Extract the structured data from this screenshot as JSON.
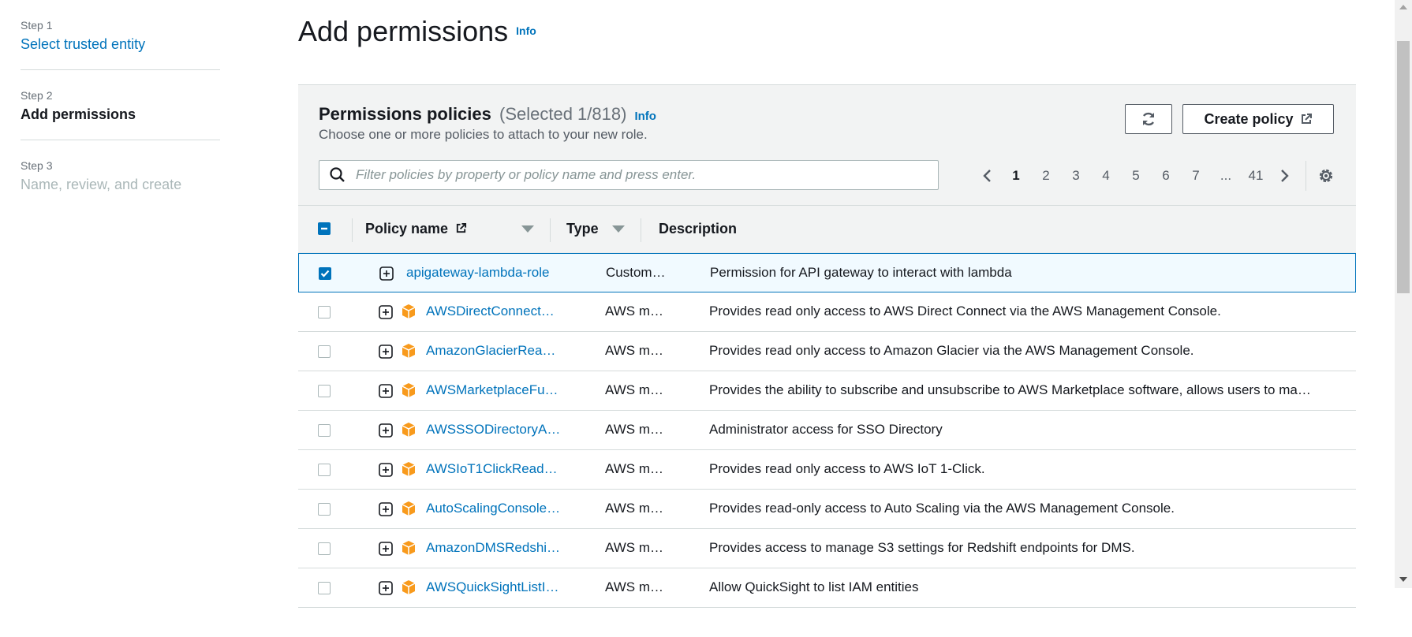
{
  "steps": [
    {
      "num": "Step 1",
      "label": "Select trusted entity",
      "state": "link"
    },
    {
      "num": "Step 2",
      "label": "Add permissions",
      "state": "current"
    },
    {
      "num": "Step 3",
      "label": "Name, review, and create",
      "state": "disabled"
    }
  ],
  "page": {
    "title": "Add permissions",
    "info": "Info"
  },
  "panel": {
    "title": "Permissions policies",
    "counter": "(Selected 1/818)",
    "info": "Info",
    "description": "Choose one or more policies to attach to your new role.",
    "create_button": "Create policy",
    "search_placeholder": "Filter policies by property or policy name and press enter."
  },
  "pagination": {
    "pages": [
      "1",
      "2",
      "3",
      "4",
      "5",
      "6",
      "7",
      "...",
      "41"
    ],
    "current": "1"
  },
  "table": {
    "headers": {
      "name": "Policy name",
      "type": "Type",
      "description": "Description"
    },
    "rows": [
      {
        "name": "apigateway-lambda-role",
        "type": "Custom…",
        "description": "Permission for API gateway to interact with lambda",
        "selected": true,
        "aws_managed": false
      },
      {
        "name": "AWSDirectConnect…",
        "type": "AWS m…",
        "description": "Provides read only access to AWS Direct Connect via the AWS Management Console.",
        "selected": false,
        "aws_managed": true
      },
      {
        "name": "AmazonGlacierRea…",
        "type": "AWS m…",
        "description": "Provides read only access to Amazon Glacier via the AWS Management Console.",
        "selected": false,
        "aws_managed": true
      },
      {
        "name": "AWSMarketplaceFu…",
        "type": "AWS m…",
        "description": "Provides the ability to subscribe and unsubscribe to AWS Marketplace software, allows users to ma…",
        "selected": false,
        "aws_managed": true
      },
      {
        "name": "AWSSSODirectoryA…",
        "type": "AWS m…",
        "description": "Administrator access for SSO Directory",
        "selected": false,
        "aws_managed": true
      },
      {
        "name": "AWSIoT1ClickRead…",
        "type": "AWS m…",
        "description": "Provides read only access to AWS IoT 1-Click.",
        "selected": false,
        "aws_managed": true
      },
      {
        "name": "AutoScalingConsole…",
        "type": "AWS m…",
        "description": "Provides read-only access to Auto Scaling via the AWS Management Console.",
        "selected": false,
        "aws_managed": true
      },
      {
        "name": "AmazonDMSRedshi…",
        "type": "AWS m…",
        "description": "Provides access to manage S3 settings for Redshift endpoints for DMS.",
        "selected": false,
        "aws_managed": true
      },
      {
        "name": "AWSQuickSightListI…",
        "type": "AWS m…",
        "description": "Allow QuickSight to list IAM entities",
        "selected": false,
        "aws_managed": true
      }
    ]
  },
  "colors": {
    "link": "#0073bb",
    "policy_icon": "#f89a1c",
    "text": "#16191f"
  },
  "icons": [
    "search-icon",
    "refresh-icon",
    "external-link-icon",
    "chevron-left-icon",
    "chevron-right-icon",
    "gear-icon",
    "expand-icon",
    "aws-policy-icon",
    "sort-caret-icon"
  ]
}
